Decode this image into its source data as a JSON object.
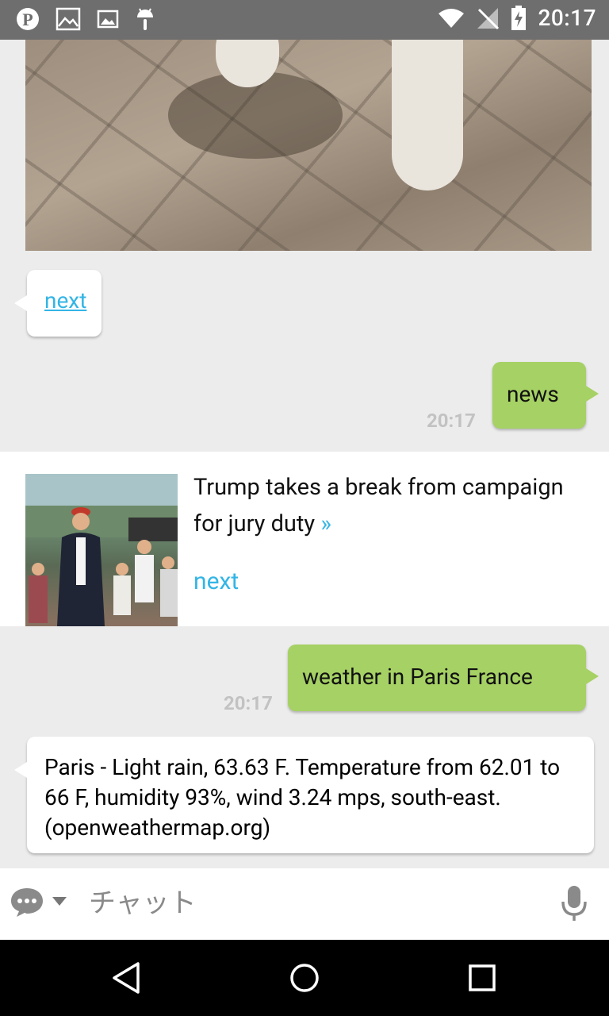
{
  "status_bar": {
    "time": "20:17",
    "left_icons": [
      "pinterest-icon",
      "image-icon",
      "gallery-icon",
      "android-icon"
    ],
    "right_icons": [
      "wifi-icon",
      "no-signal-icon",
      "battery-charging-icon"
    ]
  },
  "messages": {
    "in_next_link": "next",
    "out_news": {
      "text": "news",
      "time": "20:17"
    },
    "news_card": {
      "title": "Trump takes a break from campaign for jury duty",
      "more_glyph": "»",
      "next_label": "next"
    },
    "out_weather": {
      "text": "weather in Paris France",
      "time": "20:17"
    },
    "in_weather": "Paris - Light rain, 63.63 F. Temperature from 62.01 to 66 F, humidity 93%, wind 3.24 mps, south-east. (openweathermap.org)"
  },
  "input_bar": {
    "placeholder": "チャット",
    "left_icon": "chat-bubble-icon",
    "right_icon": "microphone-icon"
  },
  "nav_bar": {
    "buttons": [
      "back-icon",
      "home-icon",
      "recents-icon"
    ]
  },
  "colors": {
    "status_bar": "#6e6e6e",
    "chat_bg": "#ececec",
    "outgoing_bubble": "#a6d164",
    "link": "#33b5e5",
    "timestamp": "#c2c2c2"
  }
}
